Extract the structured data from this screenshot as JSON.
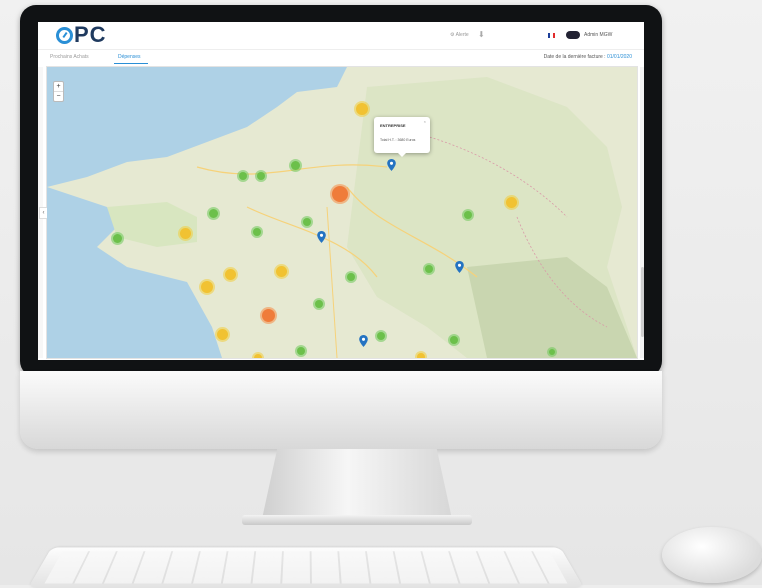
{
  "app": {
    "logo_text": "PC"
  },
  "header": {
    "alert_label": "Alerte",
    "download_icon": "download-icon",
    "flag_colors": [
      "#1d3f99",
      "#ffffff",
      "#e12b2b"
    ],
    "user_name": "Admin MGW"
  },
  "tabs": [
    {
      "label": "Prochains Achats",
      "active": false
    },
    {
      "label": "Dépenses",
      "active": true
    }
  ],
  "last_invoice": {
    "label": "Date de la dernière facture :",
    "value": "01/01/2020"
  },
  "map": {
    "zoom_in": "+",
    "zoom_out": "−",
    "collapse_arrow": "‹",
    "popup": {
      "title": "ENTREPRISE",
      "line": "Total H.T. : 3680 Euros",
      "close": "×"
    },
    "clusters_count": 26,
    "pins_count": 4
  },
  "colors": {
    "accent": "#2a8fd6",
    "logo": "#1f3a5f",
    "cluster_green": "#6cc04a",
    "cluster_yellow": "#f1c232",
    "cluster_orange": "#ef7c3a"
  }
}
